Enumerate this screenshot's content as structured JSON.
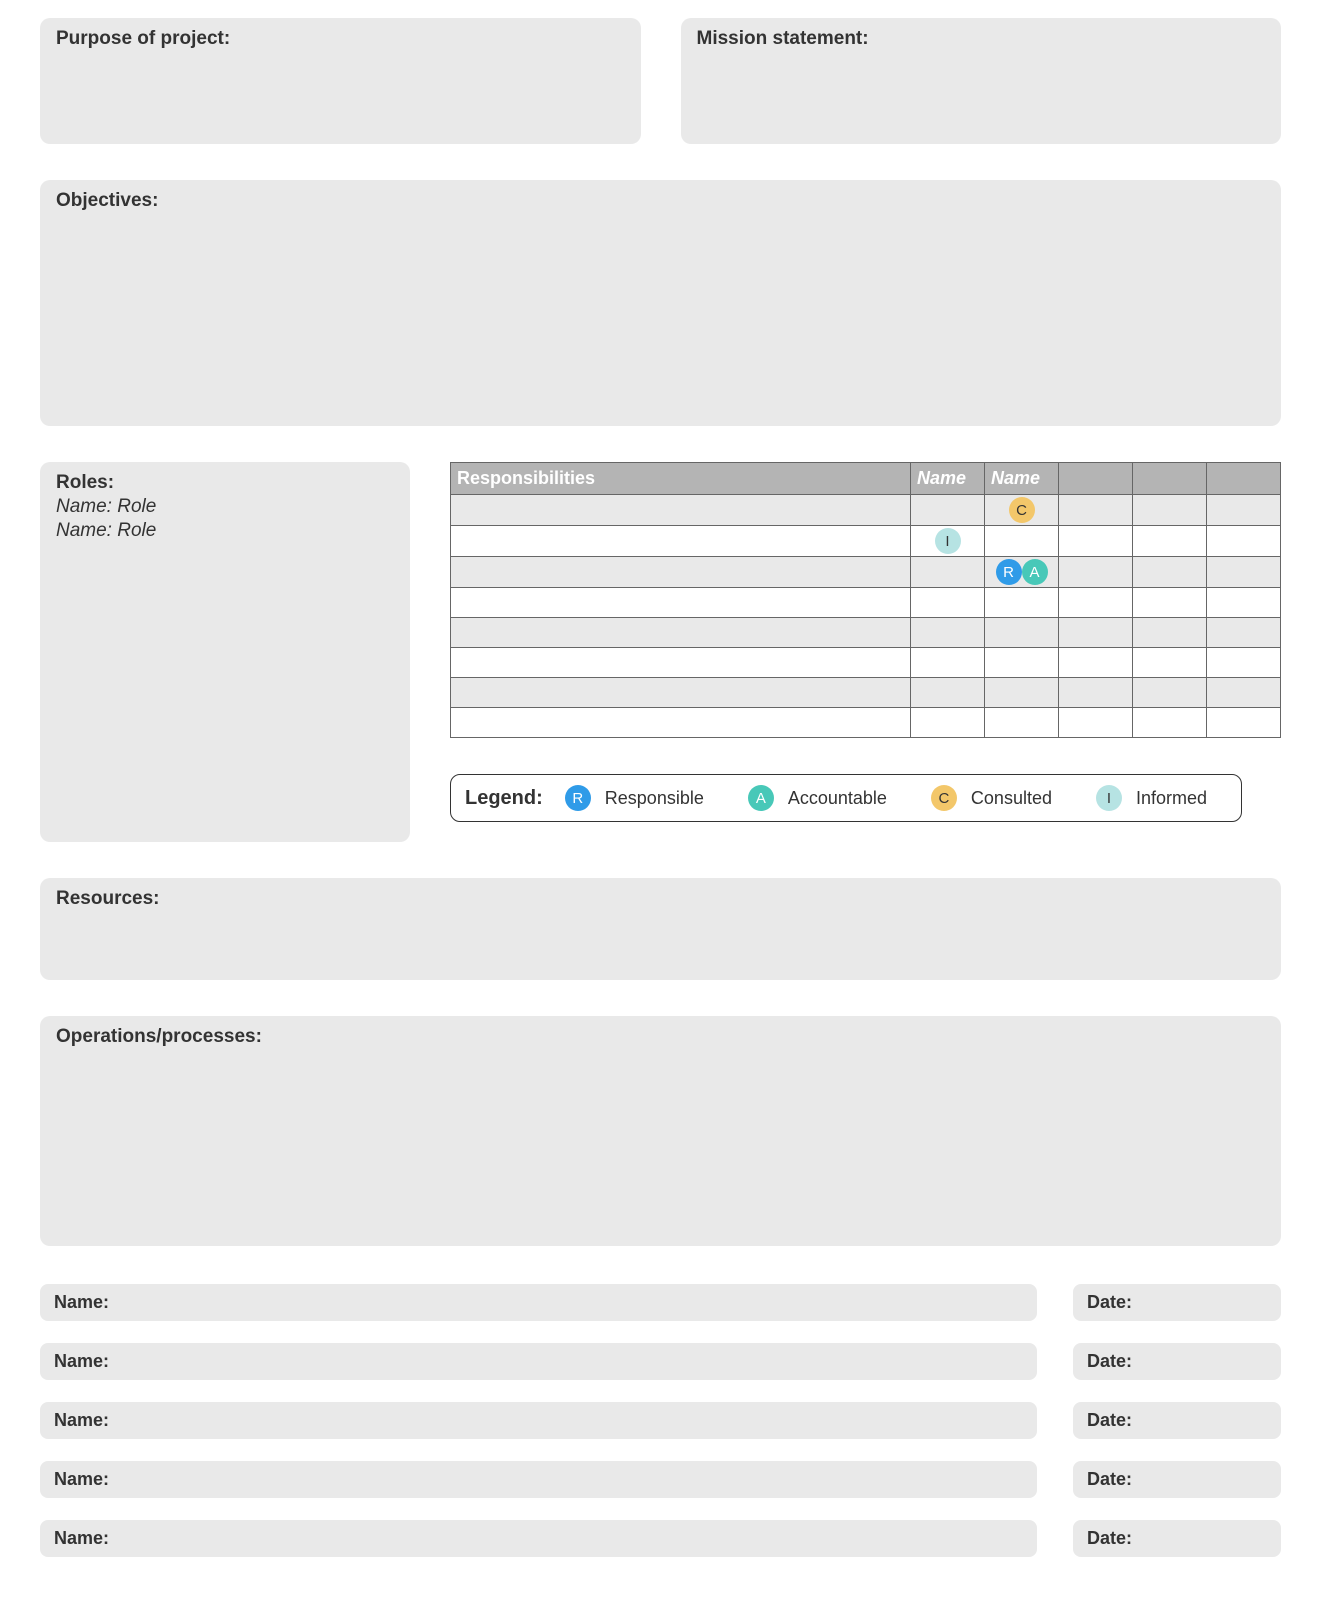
{
  "labels": {
    "purpose": "Purpose of project:",
    "mission": "Mission statement:",
    "objectives": "Objectives:",
    "roles": "Roles:",
    "resources": "Resources:",
    "operations": "Operations/processes:",
    "legend": "Legend:",
    "name": "Name:",
    "date": "Date:"
  },
  "roles_items": [
    "Name: Role",
    "Name: Role"
  ],
  "table": {
    "headers": [
      "Responsibilities",
      "Name",
      "Name",
      "",
      "",
      ""
    ],
    "rows": [
      [
        "",
        "",
        "C",
        "",
        "",
        ""
      ],
      [
        "",
        "I",
        "",
        "",
        "",
        ""
      ],
      [
        "",
        "",
        "R,A",
        "",
        "",
        ""
      ],
      [
        "",
        "",
        "",
        "",
        "",
        ""
      ],
      [
        "",
        "",
        "",
        "",
        "",
        ""
      ],
      [
        "",
        "",
        "",
        "",
        "",
        ""
      ],
      [
        "",
        "",
        "",
        "",
        "",
        ""
      ],
      [
        "",
        "",
        "",
        "",
        "",
        ""
      ]
    ]
  },
  "raci": {
    "R": {
      "label": "Responsible",
      "letter": "R",
      "bg": "#2f9be8",
      "dark": false
    },
    "A": {
      "label": "Accountable",
      "letter": "A",
      "bg": "#48c8b8",
      "dark": false
    },
    "C": {
      "label": "Consulted",
      "letter": "C",
      "bg": "#f3c76a",
      "dark": true
    },
    "I": {
      "label": "Informed",
      "letter": "I",
      "bg": "#b6e3e3",
      "dark": true
    }
  },
  "legend_order": [
    "R",
    "A",
    "C",
    "I"
  ],
  "signatures_count": 5
}
